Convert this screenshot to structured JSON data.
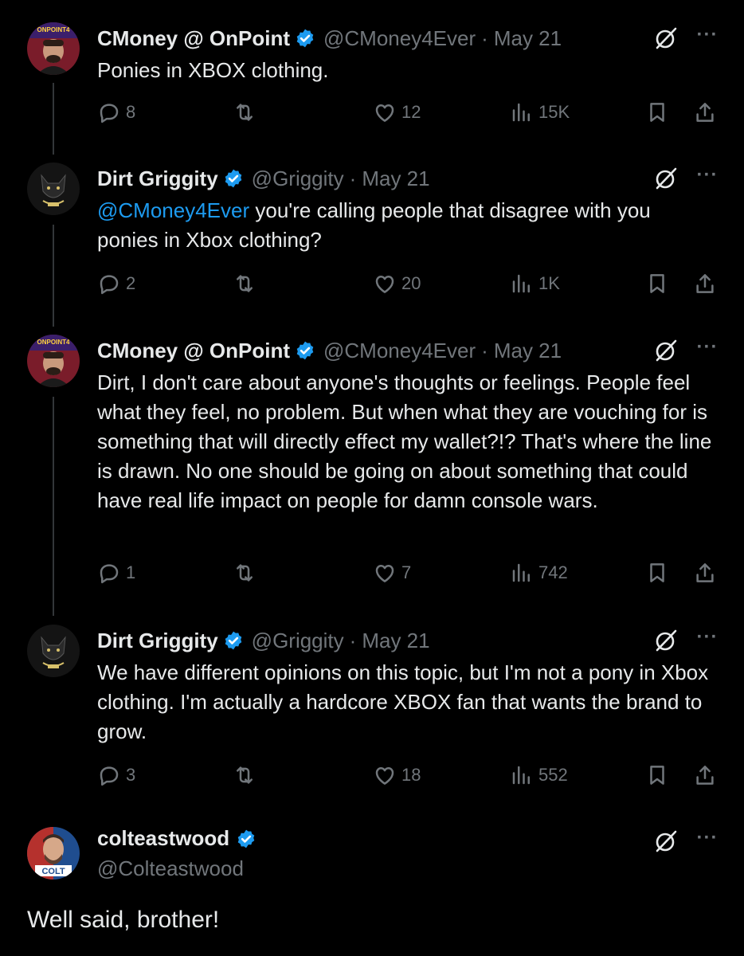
{
  "tweets": [
    {
      "name": "CMoney @ OnPoint",
      "handle": "@CMoney4Ever",
      "date": "May 21",
      "text": "Ponies in XBOX clothing.",
      "replies": "8",
      "likes": "12",
      "views": "15K"
    },
    {
      "name": "Dirt Griggity",
      "handle": "@Griggity",
      "date": "May 21",
      "mention": "@CMoney4Ever",
      "text": " you're calling people that disagree with you ponies in Xbox clothing?",
      "replies": "2",
      "likes": "20",
      "views": "1K"
    },
    {
      "name": "CMoney @ OnPoint",
      "handle": "@CMoney4Ever",
      "date": "May 21",
      "text": "Dirt, I don't care about anyone's thoughts or feelings. People feel what they feel, no problem. But when what they are vouching for is something that will directly effect my wallet?!? That's where the line is drawn. No one should be going on about something that could have real life impact on people for damn console wars.",
      "replies": "1",
      "likes": "7",
      "views": "742"
    },
    {
      "name": "Dirt Griggity",
      "handle": "@Griggity",
      "date": "May 21",
      "text": "We have different opinions on this topic, but I'm not a pony in Xbox clothing. I'm actually a hardcore XBOX fan that wants the brand to grow.",
      "replies": "3",
      "likes": "18",
      "views": "552"
    }
  ],
  "main": {
    "name": "colteastwood",
    "handle": "@Colteastwood",
    "text": "Well said, brother!",
    "avatar_text": "COLT"
  },
  "avatar_labels": {
    "cmoney": "ONPOINT4"
  },
  "separator": "·",
  "more_label": "···",
  "colors": {
    "background": "#000000",
    "text": "#e7e9ea",
    "muted": "#71767b",
    "accent": "#1d9bf0"
  }
}
